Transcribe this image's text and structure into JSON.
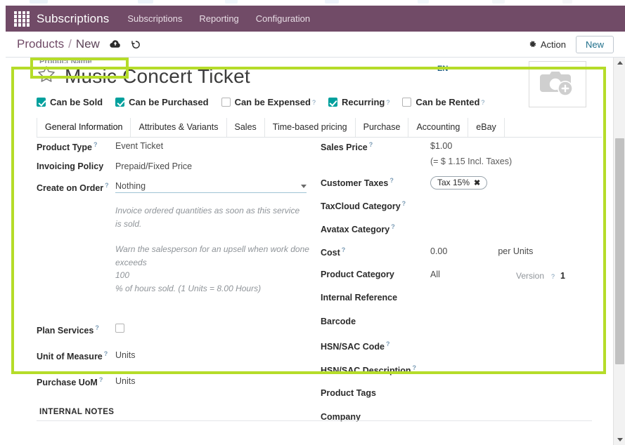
{
  "appbar": {
    "apps_icon": "apps-grid-icon",
    "title": "Subscriptions",
    "menus": [
      "Subscriptions",
      "Reporting",
      "Configuration"
    ]
  },
  "control_panel": {
    "breadcrumb_parent": "Products",
    "breadcrumb_separator": "/",
    "breadcrumb_current": "New",
    "save_icon": "cloud-upload-icon",
    "discard_icon": "undo-icon",
    "action_icon": "gear-icon",
    "action_label": "Action",
    "new_label": "New"
  },
  "form": {
    "cut_label": "Product Name",
    "star_icon": "star-icon",
    "product_title": "Music Concert Ticket",
    "language_badge": "EN",
    "image_placeholder_icon": "camera-add-icon",
    "checkboxes": [
      {
        "label": "Can be Sold",
        "checked": true,
        "help": false
      },
      {
        "label": "Can be Purchased",
        "checked": true,
        "help": false
      },
      {
        "label": "Can be Expensed",
        "checked": false,
        "help": true
      },
      {
        "label": "Recurring",
        "checked": true,
        "help": true
      },
      {
        "label": "Can be Rented",
        "checked": false,
        "help": true
      }
    ],
    "tabs": [
      {
        "label": "General Information",
        "active": true
      },
      {
        "label": "Attributes & Variants",
        "active": false
      },
      {
        "label": "Sales",
        "active": false
      },
      {
        "label": "Time-based pricing",
        "active": false
      },
      {
        "label": "Purchase",
        "active": false
      },
      {
        "label": "Accounting",
        "active": false
      },
      {
        "label": "eBay",
        "active": false
      }
    ],
    "left": {
      "product_type_label": "Product Type",
      "product_type_value": "Event Ticket",
      "invoicing_policy_label": "Invoicing Policy",
      "invoicing_policy_value": "Prepaid/Fixed Price",
      "create_on_order_label": "Create on Order",
      "create_on_order_value": "Nothing",
      "help_invoice": "Invoice ordered quantities as soon as this service is sold.",
      "help_warn_pre": "Warn the salesperson for an upsell when work done exceeds",
      "help_warn_num": "100",
      "help_warn_post": "% of hours sold. (1 Units = 8.00 Hours)",
      "plan_services_label": "Plan Services",
      "plan_services_checked": false,
      "unit_of_measure_label": "Unit of Measure",
      "unit_of_measure_value": "Units",
      "purchase_uom_label": "Purchase UoM",
      "purchase_uom_value": "Units"
    },
    "right": {
      "sales_price_label": "Sales Price",
      "sales_price_value": "$1.00",
      "sales_price_sub": "(= $ 1.15 Incl. Taxes)",
      "customer_taxes_label": "Customer Taxes",
      "customer_tax_tag": "Tax 15%",
      "tax_remove_icon": "close-icon",
      "taxcloud_category_label": "TaxCloud Category",
      "taxcloud_category_value": "",
      "avatax_category_label": "Avatax Category",
      "avatax_category_value": "",
      "cost_label": "Cost",
      "cost_value": "0.00",
      "cost_unit": "per Units",
      "product_category_label": "Product Category",
      "product_category_value": "All",
      "internal_reference_label": "Internal Reference",
      "internal_reference_value": "",
      "version_label": "Version",
      "version_value": "1",
      "barcode_label": "Barcode",
      "barcode_value": "",
      "hsn_sac_code_label": "HSN/SAC Code",
      "hsn_sac_code_value": "",
      "hsn_sac_desc_label": "HSN/SAC Description",
      "hsn_sac_desc_value": "",
      "product_tags_label": "Product Tags",
      "product_tags_value": "",
      "company_label": "Company",
      "company_value": ""
    },
    "internal_notes_heading": "INTERNAL NOTES"
  },
  "colors": {
    "brand_purple": "#714b67",
    "checkbox_teal": "#00a09d",
    "highlight_green": "#b5dc29",
    "link_blue": "#1f6f8b"
  }
}
